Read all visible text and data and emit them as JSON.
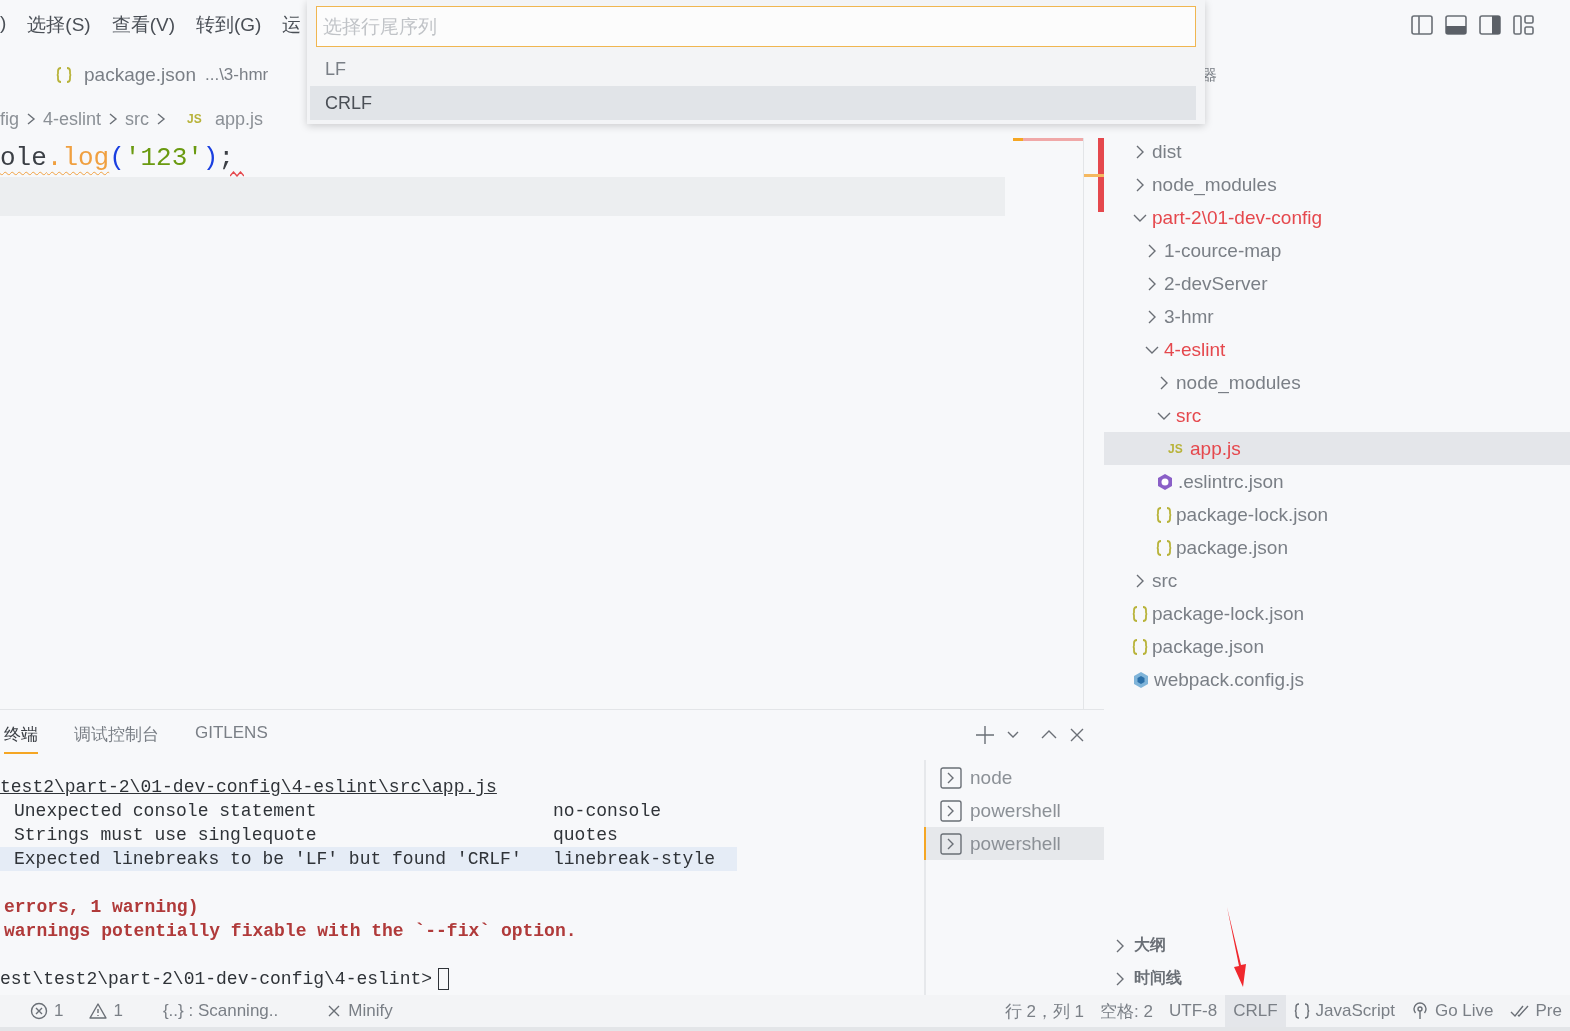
{
  "menu": [
    {
      "label": ")"
    },
    {
      "label": "选择(S)"
    },
    {
      "label": "查看(V)"
    },
    {
      "label": "转到(G)"
    },
    {
      "label": "运"
    }
  ],
  "editor_tabs": [
    {
      "label": "package.json",
      "description": "...\\3-hmr",
      "kind": "json"
    }
  ],
  "breadcrumbs": [
    {
      "label": "fig",
      "kind": "folder"
    },
    {
      "label": "4-eslint",
      "kind": "folder"
    },
    {
      "label": "src",
      "kind": "folder"
    },
    {
      "label": "app.js",
      "kind": "js",
      "badge": "JS"
    }
  ],
  "code_lines": [
    {
      "eol_error": true,
      "tokens": [
        {
          "text": "ole",
          "kind": "identifier",
          "warning": true
        },
        {
          "text": ".log",
          "kind": "member",
          "warning": true
        },
        {
          "text": "(",
          "kind": "paren",
          "warning": false
        },
        {
          "text": "'123'",
          "kind": "string",
          "warning": false
        },
        {
          "text": ")",
          "kind": "paren",
          "warning": false
        },
        {
          "text": ";",
          "kind": "punct",
          "warning": false
        }
      ]
    },
    {
      "current": true,
      "eol_error": false
    }
  ],
  "quick_pick": {
    "placeholder": "选择行尾序列",
    "items": [
      {
        "label": "LF",
        "selected": false
      },
      {
        "label": "CRLF",
        "selected": true
      }
    ]
  },
  "explorer": {
    "header": "器",
    "tree": [
      {
        "name": "dist",
        "kind": "folder",
        "expanded": false,
        "has_problems": false,
        "selected": false
      },
      {
        "name": "node_modules",
        "kind": "folder",
        "expanded": false,
        "has_problems": false,
        "selected": false
      },
      {
        "name": "part-2\\01-dev-config",
        "kind": "folder",
        "expanded": true,
        "has_problems": true,
        "selected": false,
        "children": [
          {
            "name": "1-cource-map",
            "kind": "folder",
            "expanded": false,
            "has_problems": false,
            "selected": false
          },
          {
            "name": "2-devServer",
            "kind": "folder",
            "expanded": false,
            "has_problems": false,
            "selected": false
          },
          {
            "name": "3-hmr",
            "kind": "folder",
            "expanded": false,
            "has_problems": false,
            "selected": false
          },
          {
            "name": "4-eslint",
            "kind": "folder",
            "expanded": true,
            "has_problems": true,
            "selected": false,
            "children": [
              {
                "name": "node_modules",
                "kind": "folder",
                "expanded": false,
                "has_problems": false,
                "selected": false
              },
              {
                "name": "src",
                "kind": "folder",
                "expanded": true,
                "has_problems": true,
                "selected": false,
                "children": [
                  {
                    "name": "app.js",
                    "kind": "js",
                    "badge": "JS",
                    "has_problems": true,
                    "selected": true
                  }
                ]
              },
              {
                "name": ".eslintrc.json",
                "kind": "eslint",
                "has_problems": false,
                "selected": false
              },
              {
                "name": "package-lock.json",
                "kind": "json",
                "has_problems": false,
                "selected": false
              },
              {
                "name": "package.json",
                "kind": "json",
                "has_problems": false,
                "selected": false
              }
            ]
          }
        ]
      },
      {
        "name": "src",
        "kind": "folder",
        "expanded": false,
        "has_problems": false,
        "selected": false
      },
      {
        "name": "package-lock.json",
        "kind": "json",
        "has_problems": false,
        "selected": false
      },
      {
        "name": "package.json",
        "kind": "json",
        "has_problems": false,
        "selected": false
      },
      {
        "name": "webpack.config.js",
        "kind": "webpack",
        "has_problems": false,
        "selected": false
      }
    ],
    "sections": [
      {
        "label": "大纲",
        "expanded": false
      },
      {
        "label": "时间线",
        "expanded": false
      }
    ]
  },
  "panel": {
    "tabs": [
      {
        "label": "终端",
        "selected": true
      },
      {
        "label": "调试控制台",
        "selected": false
      },
      {
        "label": "GITLENS",
        "selected": false
      }
    ],
    "terminal_lines": [
      {
        "kind": "path",
        "text": "test2\\part-2\\01-dev-config\\4-eslint\\src\\app.js"
      },
      {
        "kind": "problem",
        "message": "Unexpected console statement",
        "rule": "no-console",
        "selected": false
      },
      {
        "kind": "problem",
        "message": "Strings must use singlequote",
        "rule": "quotes",
        "selected": false
      },
      {
        "kind": "problem",
        "message": "Expected linebreaks to be 'LF' but found 'CRLF'",
        "rule": "linebreak-style",
        "selected": true
      },
      {
        "kind": "blank"
      },
      {
        "kind": "summary",
        "text": "errors, 1 warning)"
      },
      {
        "kind": "summary",
        "text": "warnings potentially fixable with the `--fix` option."
      },
      {
        "kind": "blank"
      },
      {
        "kind": "prompt",
        "text": "est\\test2\\part-2\\01-dev-config\\4-eslint>"
      }
    ],
    "sessions": [
      {
        "label": "node",
        "selected": false
      },
      {
        "label": "powershell",
        "selected": false
      },
      {
        "label": "powershell",
        "selected": true
      }
    ]
  },
  "status_bar": {
    "left": [
      {
        "kind": "errors",
        "text": "1"
      },
      {
        "kind": "warnings",
        "text": "1"
      },
      {
        "kind": "text",
        "text": "{..} : Scanning.."
      },
      {
        "kind": "minify",
        "text": "Minify"
      }
    ],
    "right": [
      {
        "kind": "text",
        "text": "行 2，列 1",
        "hovered": false
      },
      {
        "kind": "text",
        "text": "空格: 2",
        "hovered": false
      },
      {
        "kind": "text",
        "text": "UTF-8",
        "hovered": false
      },
      {
        "kind": "text",
        "text": "CRLF",
        "hovered": true
      },
      {
        "kind": "braces",
        "text": "JavaScript",
        "hovered": false
      },
      {
        "kind": "golive",
        "text": "Go Live",
        "hovered": false
      },
      {
        "kind": "prettier",
        "text": "Pre",
        "hovered": false
      }
    ]
  },
  "annotations": [
    {
      "kind": "arrow"
    }
  ]
}
